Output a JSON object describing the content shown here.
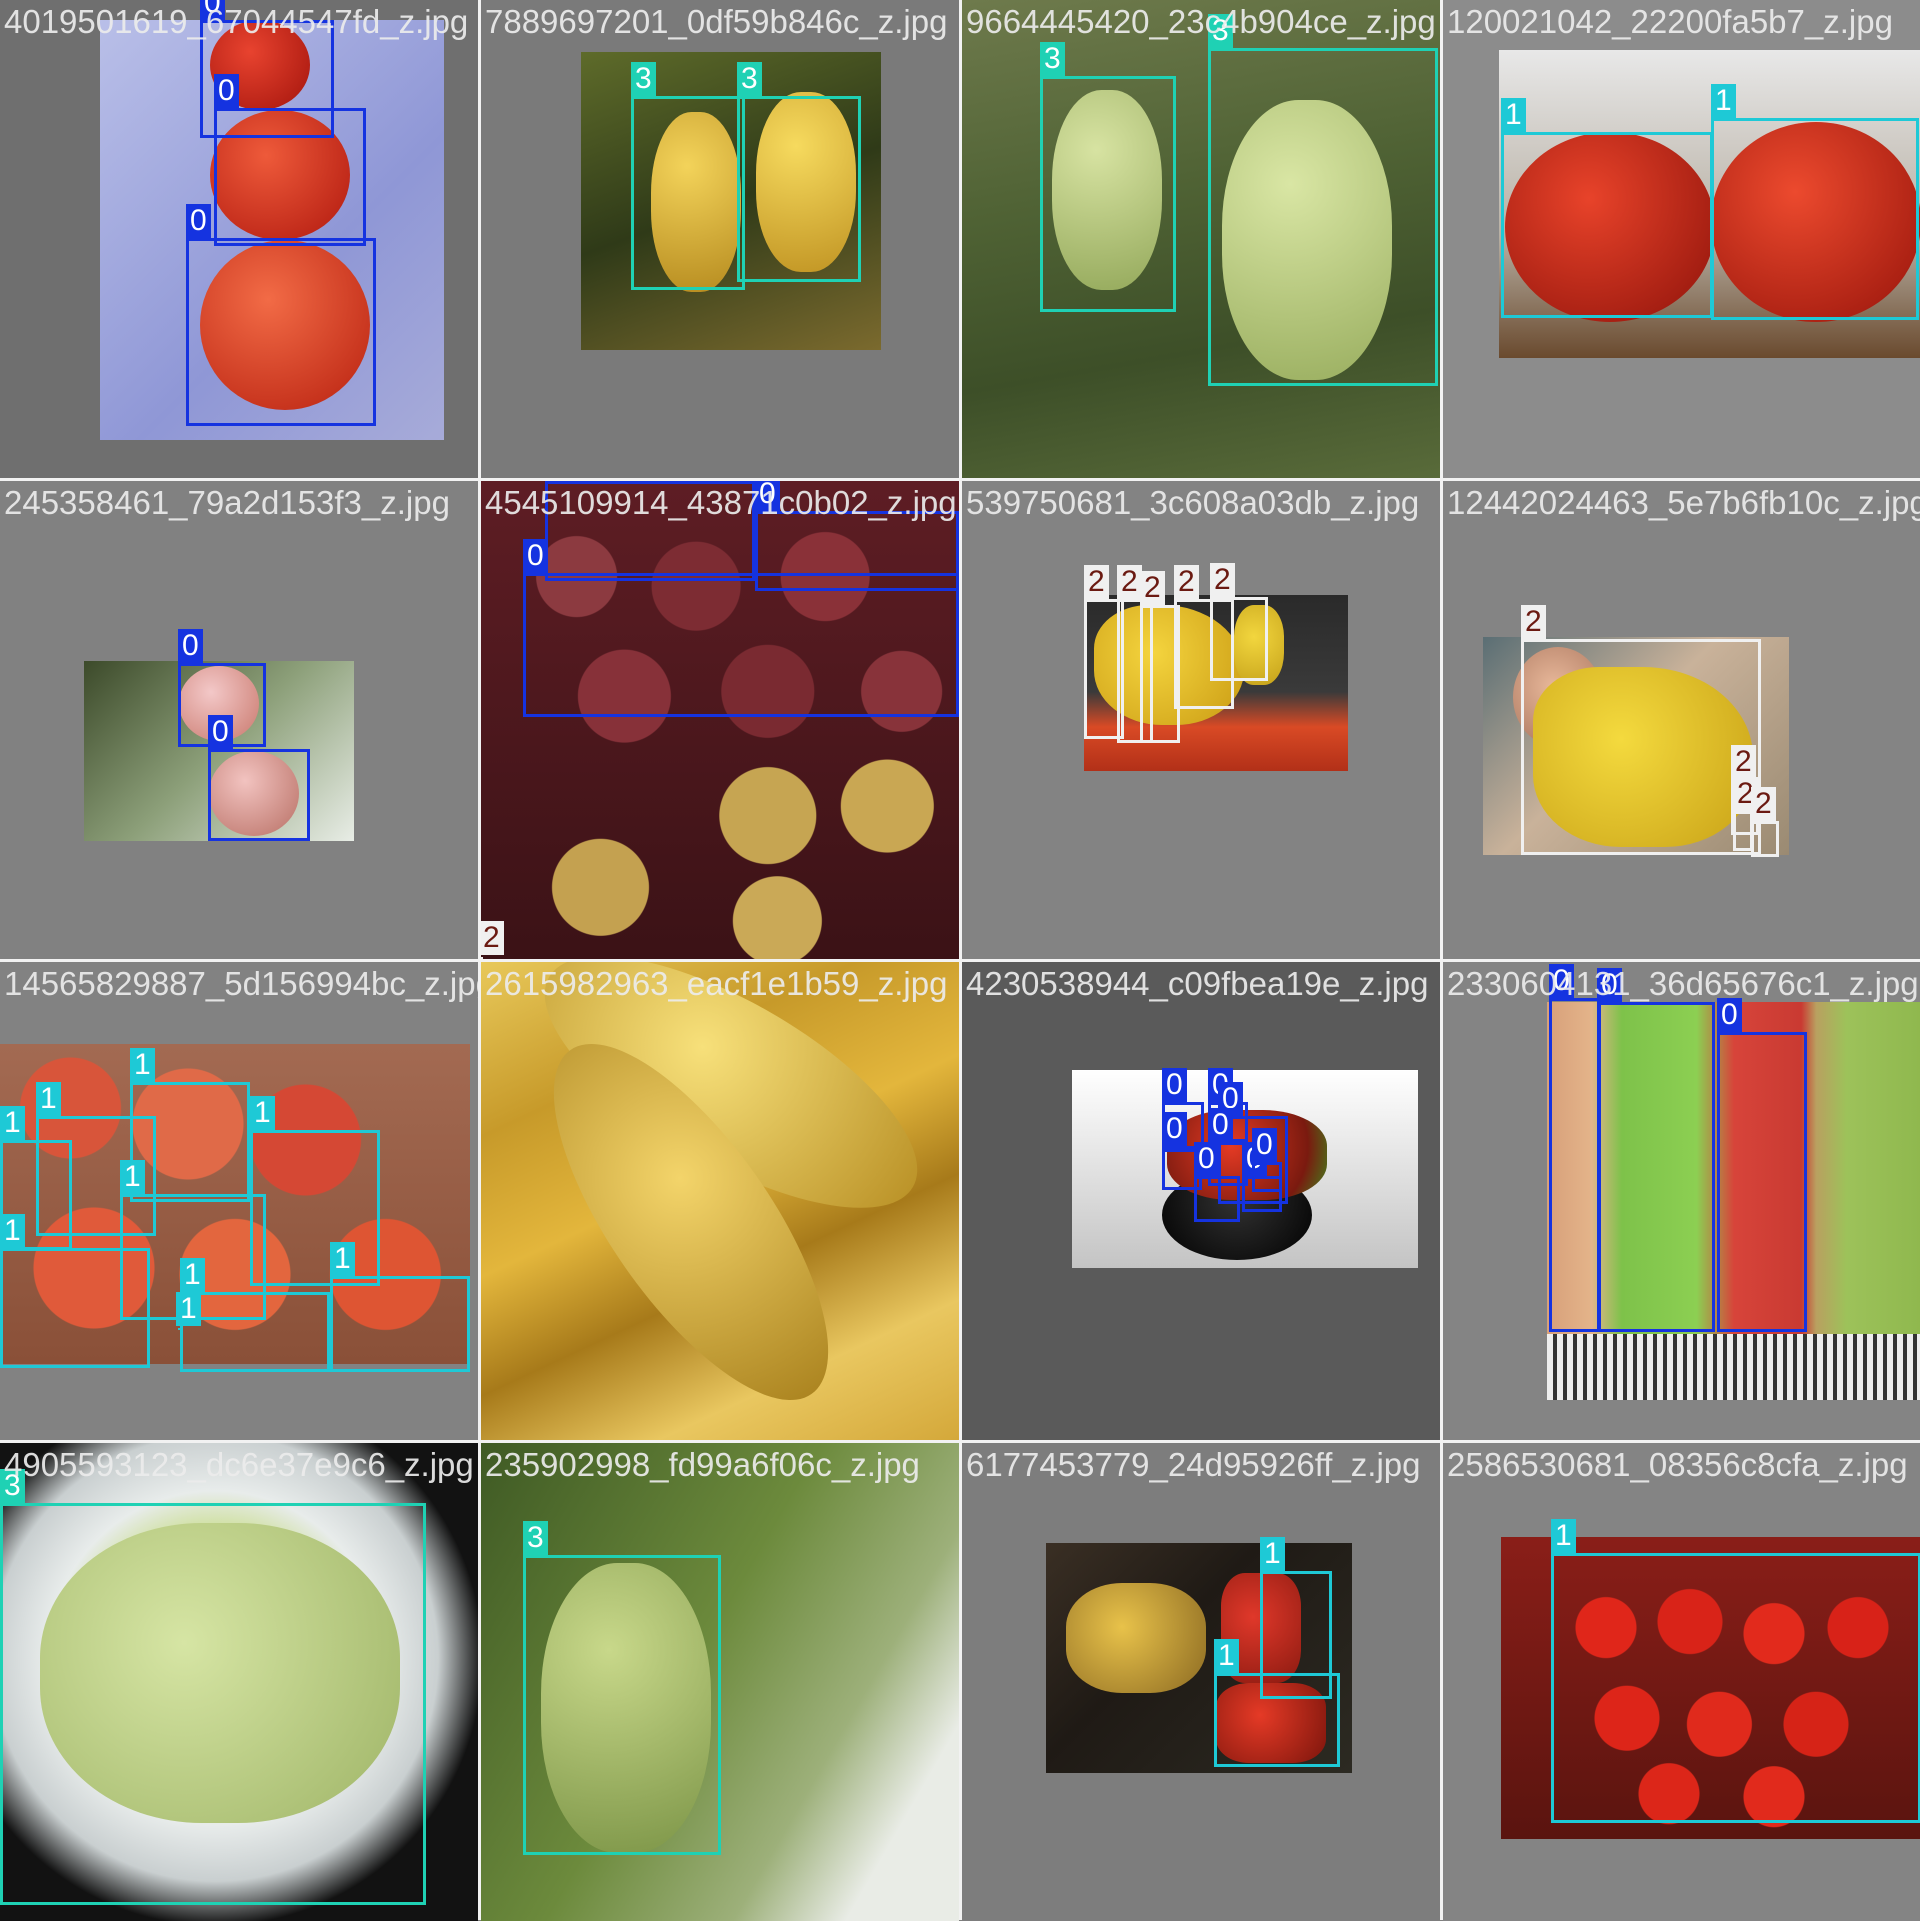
{
  "colors": {
    "class_0": "#1533e0",
    "class_1": "#1ec9d6",
    "class_2": "#f0f0f0",
    "class_3": "#1fd1b4",
    "tile_gray": "#7f7f7f"
  },
  "tiles": [
    {
      "filename": "4019501619_67044547fd_z.jpg",
      "labels": [
        "0",
        "0",
        "0"
      ]
    },
    {
      "filename": "7889697201_0df59b846c_z.jpg",
      "labels": [
        "3",
        "3"
      ]
    },
    {
      "filename": "9664445420_23c4b904ce_z.jpg",
      "labels": [
        "3",
        "3"
      ]
    },
    {
      "filename": "120021042_22200fa5b7_z.jpg",
      "labels": [
        "1",
        "1"
      ]
    },
    {
      "filename": "245358461_79a2d153f3_z.jpg",
      "labels": [
        "0",
        "0"
      ]
    },
    {
      "filename": "4545109914_43871c0b02_z.jpg",
      "labels": [
        "0",
        "0",
        "0",
        "2"
      ]
    },
    {
      "filename": "539750681_3c608a03db_z.jpg",
      "labels": [
        "2",
        "2",
        "2",
        "2",
        "2"
      ]
    },
    {
      "filename": "12442024463_5e7b6fb10c_z.jpg",
      "labels": [
        "2",
        "2",
        "2",
        "2"
      ]
    },
    {
      "filename": "14565829887_5d156994bc_z.jpg",
      "labels": [
        "1",
        "1",
        "1",
        "1",
        "1",
        "1",
        "1",
        "1",
        "1"
      ]
    },
    {
      "filename": "2615982963_eacf1e1b59_z.jpg",
      "labels": []
    },
    {
      "filename": "4230538944_c09fbea19e_z.jpg",
      "labels": [
        "0",
        "0",
        "0",
        "0",
        "0",
        "0",
        "0",
        "0"
      ]
    },
    {
      "filename": "2330604131_36d65676c1_z.jpg",
      "labels": [
        "0",
        "0",
        "0"
      ]
    },
    {
      "filename": "4905593123_dc6e37e9c6_z.jpg",
      "labels": [
        "3"
      ]
    },
    {
      "filename": "235902998_fd99a6f06c_z.jpg",
      "labels": [
        "3"
      ]
    },
    {
      "filename": "6177453779_24d95926ff_z.jpg",
      "labels": [
        "1",
        "1"
      ]
    },
    {
      "filename": "2586530681_08356c8cfa_z.jpg",
      "labels": [
        "1"
      ]
    }
  ]
}
